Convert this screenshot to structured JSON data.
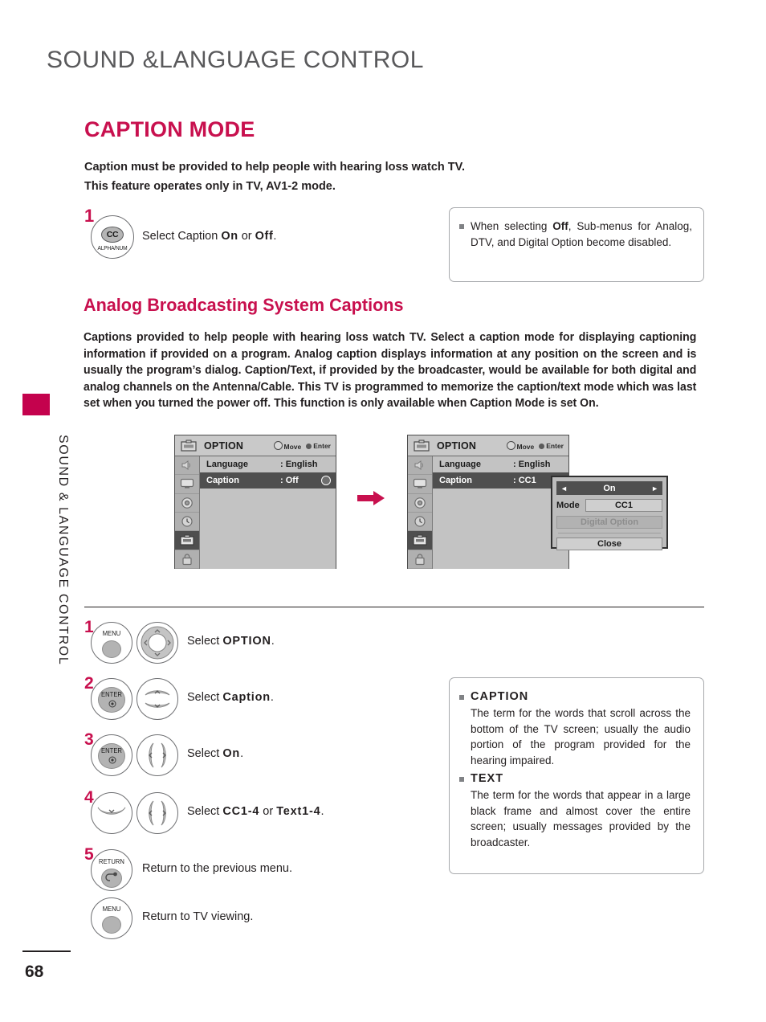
{
  "page": {
    "chapter_title": "SOUND &LANGUAGE CONTROL",
    "side_tab_label": "SOUND & LANGUAGE CONTROL",
    "page_number": "68",
    "accent_color": "#c8104e",
    "body_color": "#231f20"
  },
  "section": {
    "title": "CAPTION MODE",
    "intro_line1": "Caption must be provided to help people with hearing loss watch TV.",
    "intro_line2": "This feature operates only in TV, AV1-2 mode."
  },
  "step1": {
    "number": "1",
    "button_icon_label": "CC",
    "button_sub_label": "ALPHA/NUM",
    "text_before": "Select Caption ",
    "text_bold_on": "On",
    "text_middle": " or ",
    "text_bold_off": "Off",
    "text_after": "."
  },
  "note_off": {
    "text_1": "When selecting ",
    "bold_1": "Off",
    "text_2": ", Sub-menus for Analog, DTV, and Digital Option become disabled."
  },
  "analog": {
    "heading": "Analog Broadcasting System Captions",
    "paragraph_1": "Captions provided to help people with hearing loss watch TV. Select a caption mode for displaying captioning information if provided on a program. Analog caption displays information at any position on the screen and is usually the program’s dialog. Caption/Text, if provided by the broadcaster, would be available for both digital and analog channels on the Antenna/Cable. This TV is programmed to memorize the caption/text mode which was last set when you turned the power off. This function is only available when ",
    "paragraph_bold_caption": "Caption",
    "paragraph_2": " Mode is set ",
    "paragraph_bold_on": "On",
    "paragraph_3": "."
  },
  "osd_left": {
    "title": "OPTION",
    "hint_move": "Move",
    "hint_enter": "Enter",
    "rows": [
      {
        "label": "Language",
        "value": ": English",
        "selected": false
      },
      {
        "label": "Caption",
        "value": ": Off",
        "selected": true
      }
    ],
    "rail_icons": [
      "audio-icon",
      "picture-icon",
      "setup-icon",
      "time-icon",
      "option-icon",
      "lock-icon"
    ],
    "rail_active_index": 4
  },
  "osd_right": {
    "title": "OPTION",
    "hint_move": "Move",
    "hint_enter": "Enter",
    "rows": [
      {
        "label": "Language",
        "value": ": English",
        "selected": false
      },
      {
        "label": "Caption",
        "value": ": CC1",
        "selected": true
      }
    ],
    "rail_icons": [
      "audio-icon",
      "picture-icon",
      "setup-icon",
      "time-icon",
      "option-icon",
      "lock-icon"
    ],
    "rail_active_index": 4,
    "popup": {
      "header_value": "On",
      "left_arrow": "◄",
      "right_arrow": "►",
      "mode_label": "Mode",
      "mode_value": "CC1",
      "digital_option_label": "Digital Option",
      "close_label": "Close"
    }
  },
  "remote_steps": [
    {
      "number": "1",
      "button_label": "MENU",
      "nav_type": "dpad",
      "text_before": "Select ",
      "text_bold": "OPTION",
      "text_after": "."
    },
    {
      "number": "2",
      "button_label": "ENTER",
      "nav_type": "updown",
      "text_before": "Select ",
      "text_bold": "Caption",
      "text_after": "."
    },
    {
      "number": "3",
      "button_label": "ENTER",
      "nav_type": "leftright",
      "text_before": "Select ",
      "text_bold": "On",
      "text_after": "."
    },
    {
      "number": "4",
      "button_label": "",
      "nav_type": "leftright",
      "text_before": "Select ",
      "text_bold": "CC1-4",
      "text_middle": " or ",
      "text_bold2": "Text1-4",
      "text_after": "."
    },
    {
      "number": "5",
      "button_label": "RETURN",
      "nav_type": "none",
      "text_before": "Return to the previous menu.",
      "text_bold": "",
      "text_after": ""
    },
    {
      "number": "",
      "button_label": "MENU",
      "nav_type": "none",
      "text_before": "Return to TV viewing.",
      "text_bold": "",
      "text_after": ""
    }
  ],
  "note_terms": {
    "caption_head": "CAPTION",
    "caption_body": "The term for the words that scroll across the bottom of the TV screen; usually the audio portion of the program provided for the hearing impaired.",
    "text_head": "TEXT",
    "text_body": "The term for the words that appear in a large black frame and almost cover the entire screen; usually messages provided by the broadcaster."
  }
}
